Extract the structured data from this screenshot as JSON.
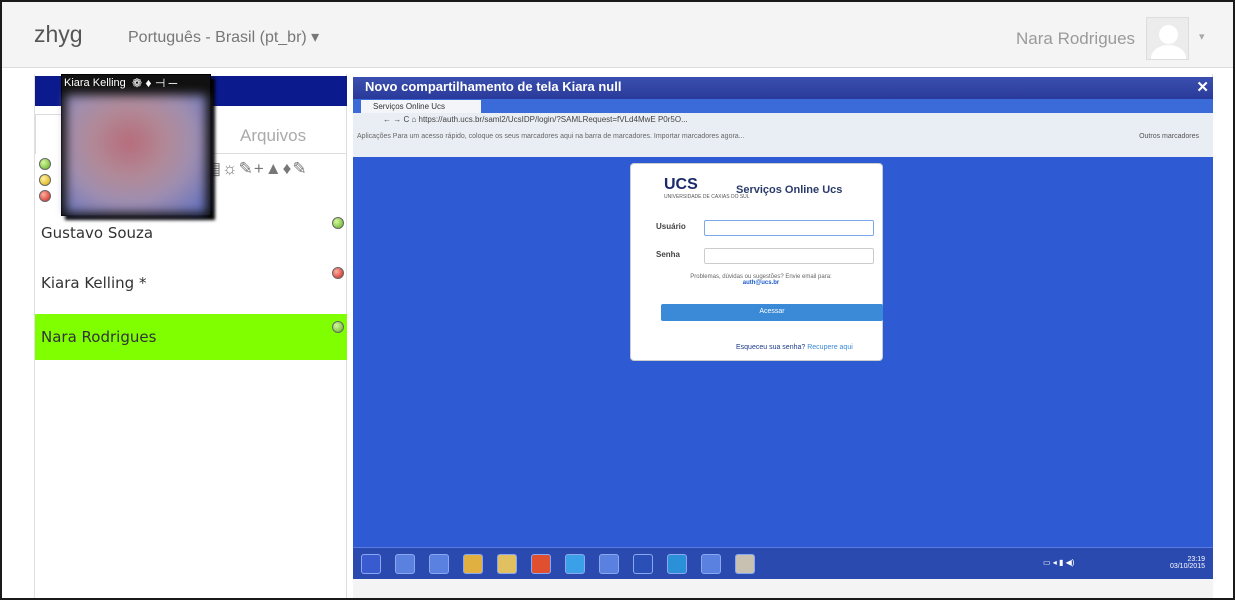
{
  "topbar": {
    "brand": "zhyg",
    "language": "Português - Brasil (pt_br) ▾",
    "username": "Nara Rodrigues",
    "caret": "▾"
  },
  "video": {
    "name": "Kiara Kelling",
    "controls": "❁ ♦ ⊣ ─"
  },
  "left": {
    "files_tab": "Arquivos",
    "tools": "▤☼✎+▲♦✎"
  },
  "participants": [
    {
      "name": "Gustavo Souza",
      "status": "green"
    },
    {
      "name": "Kiara Kelling *",
      "status": "red"
    },
    {
      "name": "Nara Rodrigues",
      "status": "green",
      "active": true
    }
  ],
  "share": {
    "title": "Novo compartilhamento de tela  Kiara null",
    "close": "✕",
    "browser_tab": "Serviços Online Ucs",
    "address": "← → C ⌂  https://auth.ucs.br/saml2/UcsIDP/login/?SAMLRequest=fVLd4MwE P0r5O...",
    "bookmarks": "Aplicações  Para um acesso rápido, coloque os seus marcadores aqui na barra de marcadores. Importar marcadores agora...",
    "other_bookmarks": "Outros marcadores",
    "login": {
      "logo": "UCS",
      "logo_sub": "UNIVERSIDADE DE CAXIAS DO SUL",
      "title": "Serviços Online Ucs",
      "user_label": "Usuário",
      "pass_label": "Senha",
      "help": "Problemas, dúvidas ou sugestões? Envie email para:",
      "help_email": "auth@ucs.br",
      "button": "Acessar",
      "forgot": "Esqueceu sua senha?",
      "recover": "Recupere aqui"
    },
    "clock_time": "23:19",
    "clock_date": "03/10/2015"
  },
  "colors": {
    "header": "#0b1a8c",
    "active_row": "#7fff00",
    "desktop": "#2e5bd4"
  }
}
